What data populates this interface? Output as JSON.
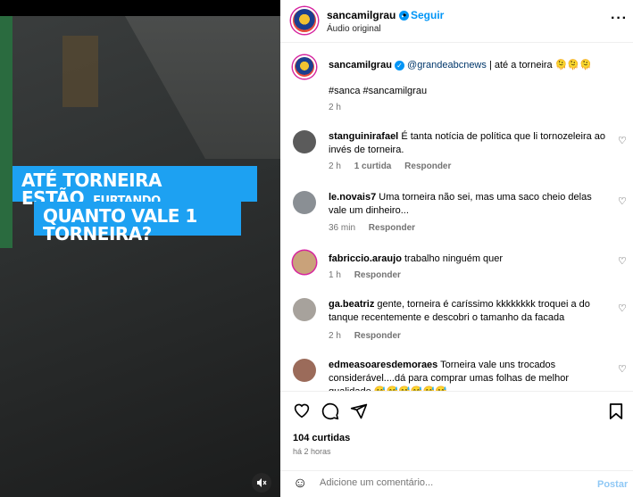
{
  "video": {
    "caption_line1": "ATÉ TORNEIRA ESTÃO",
    "caption_line1_small": "FURTANDO",
    "caption_line2": "QUANTO VALE 1 TORNEIRA?",
    "mute_icon": "volume-muted-icon"
  },
  "header": {
    "username": "sancamilgrau",
    "dot": "•",
    "follow_label": "Seguir",
    "audio_label": "Áudio original",
    "more_label": "···"
  },
  "post": {
    "username": "sancamilgrau",
    "mention": "@grandeabcnews",
    "text": " | até a torneira 🫠🫠🫠",
    "hashtags": "#sanca #sancamilgrau",
    "time": "2 h"
  },
  "comments": [
    {
      "user": "stanguinirafael",
      "text": "É tanta notícia de política que li tornozeleira ao invés de torneira.",
      "time": "2 h",
      "likes": "1 curtida",
      "reply": "Responder"
    },
    {
      "user": "le.novais7",
      "text": "Uma torneira não sei, mas uma saco cheio delas vale um dinheiro...",
      "time": "36 min",
      "likes": "",
      "reply": "Responder"
    },
    {
      "user": "fabriccio.araujo",
      "text": "trabalho ninguém quer",
      "time": "1 h",
      "likes": "",
      "reply": "Responder"
    },
    {
      "user": "ga.beatriz",
      "text": "gente, torneira é caríssimo kkkkkkkk troquei a do tanque recentemente e descobri o tamanho da facada",
      "time": "2 h",
      "likes": "",
      "reply": "Responder"
    },
    {
      "user": "edmeasoaresdemoraes",
      "text": "Torneira vale uns trocados considerável....dá para comprar umas folhas de melhor qualidade 😅😅😅😅😅😅",
      "time": "",
      "likes": "",
      "reply": ""
    }
  ],
  "actions": {
    "likes_count": "104 curtidas",
    "posted_ago": "há 2 horas",
    "comment_placeholder": "Adicione um comentário...",
    "post_label": "Postar"
  }
}
